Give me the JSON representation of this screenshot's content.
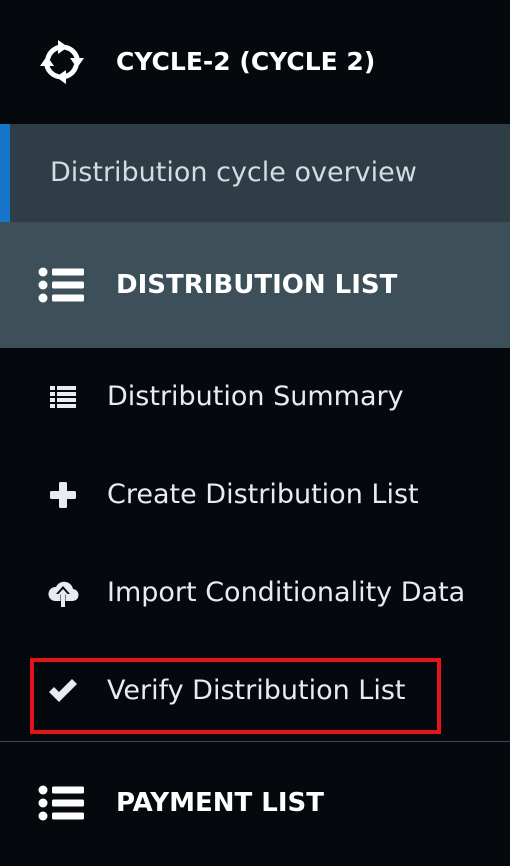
{
  "cycle": {
    "title": "CYCLE-2 (CYCLE 2)",
    "icon": "cycle-refresh-icon"
  },
  "overview": {
    "label": "Distribution cycle overview"
  },
  "distribution_list": {
    "label": "DISTRIBUTION LIST",
    "icon": "list-icon",
    "items": [
      {
        "label": "Distribution Summary",
        "icon": "list-alt-icon"
      },
      {
        "label": "Create Distribution List",
        "icon": "plus-icon"
      },
      {
        "label": "Import Conditionality Data",
        "icon": "cloud-upload-icon"
      },
      {
        "label": "Verify Distribution List",
        "icon": "check-icon"
      }
    ]
  },
  "payment_list": {
    "label": "PAYMENT LIST",
    "icon": "list-icon"
  },
  "colors": {
    "background": "#05080c",
    "overview_bg": "#2e3d46",
    "active_section_bg": "#3d4f59",
    "accent": "#1675c8",
    "highlight": "#e4141b"
  }
}
